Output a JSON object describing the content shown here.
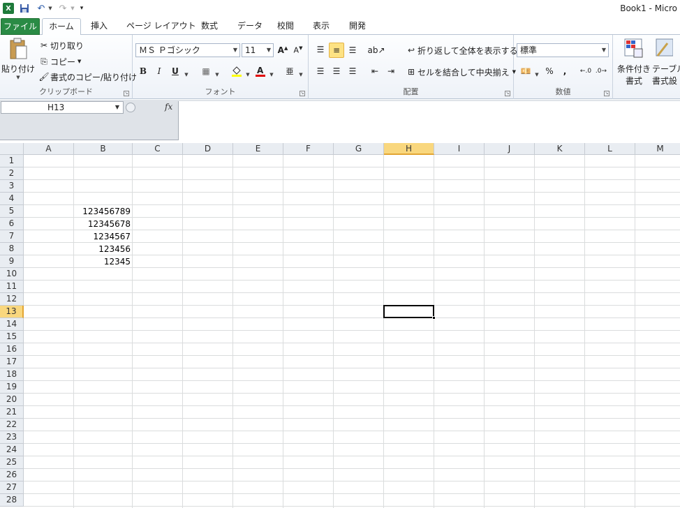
{
  "title": "Book1 - Micro",
  "tabs": [
    "ファイル",
    "ホーム",
    "挿入",
    "ページ レイアウト",
    "数式",
    "データ",
    "校閲",
    "表示",
    "開発"
  ],
  "ribbon": {
    "clipboard": {
      "label": "クリップボード",
      "paste": "貼り付け",
      "cut": "切り取り",
      "copy": "コピー",
      "format_painter": "書式のコピー/貼り付け"
    },
    "font": {
      "label": "フォント",
      "font_name": "ＭＳ Ｐゴシック",
      "font_size": "11",
      "bold": "B",
      "italic": "I",
      "underline": "U"
    },
    "alignment": {
      "label": "配置",
      "wrap_text": "折り返して全体を表示する",
      "merge_center": "セルを結合して中央揃え"
    },
    "number": {
      "label": "数値",
      "format": "標準",
      "percent": "%",
      "comma": ","
    },
    "styles": {
      "conditional": "条件付き",
      "conditional2": "書式",
      "table": "テーブル",
      "table2": "書式設"
    }
  },
  "formula_bar": {
    "name_box": "H13",
    "fx": "fx",
    "content": ""
  },
  "columns": [
    "A",
    "B",
    "C",
    "D",
    "E",
    "F",
    "G",
    "H",
    "I",
    "J",
    "K",
    "L",
    "M"
  ],
  "rows": [
    "1",
    "2",
    "3",
    "4",
    "5",
    "6",
    "7",
    "8",
    "9",
    "10",
    "11",
    "12",
    "13",
    "14",
    "15",
    "16",
    "17",
    "18",
    "19",
    "20",
    "21",
    "22",
    "23",
    "24",
    "25",
    "26",
    "27",
    "28"
  ],
  "selected": {
    "column": "H",
    "row": "13"
  },
  "cells": [
    {
      "ref": "B5",
      "value": "123456789"
    },
    {
      "ref": "B6",
      "value": "12345678"
    },
    {
      "ref": "B7",
      "value": "1234567"
    },
    {
      "ref": "B8",
      "value": "123456"
    },
    {
      "ref": "B9",
      "value": "12345"
    }
  ],
  "colors": {
    "file_tab": "#2a8b45",
    "selected_header": "#f9d77e"
  }
}
